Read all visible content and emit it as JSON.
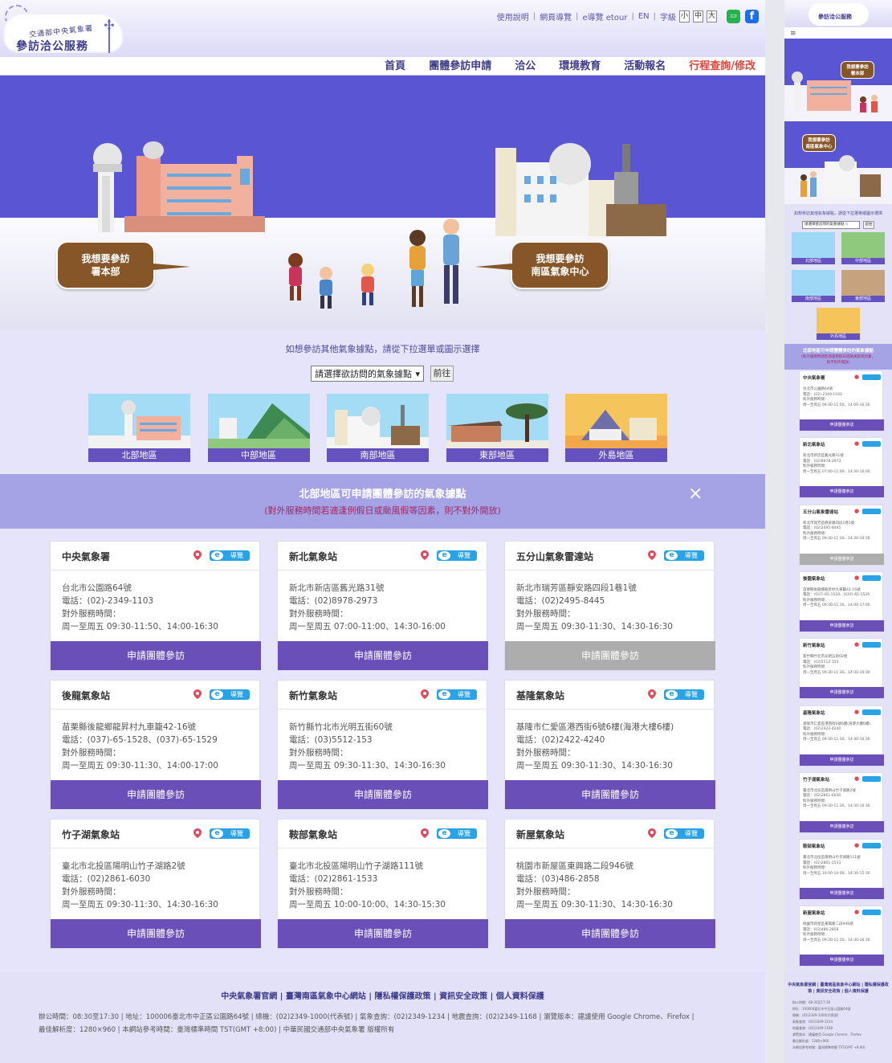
{
  "header": {
    "logo_sub": "交通部中央氣象署",
    "logo_main": "參訪洽公服務",
    "util_links": [
      "使用說明",
      "網頁導覽",
      "e導覽 etour",
      "EN"
    ],
    "font_label": "字級",
    "font_sizes": [
      "小",
      "中",
      "大"
    ],
    "line_label": "LINE",
    "fb_label": "f"
  },
  "nav": [
    "首頁",
    "團體參訪申請",
    "洽公",
    "環境教育",
    "活動報名",
    "行程查詢/修改"
  ],
  "hero": {
    "bubble_left": "我想要參訪\n署本部",
    "bubble_right": "我想要參訪\n南區氣象中心"
  },
  "selector": {
    "prompt": "如想參訪其他氣象據點，請從下拉選單或圖示選擇",
    "select_value": "請選擇欲訪問的氣象據點",
    "go_label": "前往"
  },
  "regions": [
    "北部地區",
    "中部地區",
    "南部地區",
    "東部地區",
    "外島地區"
  ],
  "band": {
    "title": "北部地區可申請團體參訪的氣象據點",
    "note": "(對外服務時間若適逢例假日或颱風假等因素，則不對外開放)",
    "close": "×"
  },
  "tag_label": "導覽",
  "tag_e": "e",
  "cards": [
    {
      "title": "中央氣象署",
      "addr": "台北市公園路64號",
      "tel": "電話：(02)-2349-1103",
      "hours_label": "對外服務時間：",
      "hours": "周一至周五 09:30-11:50、14:00-16:30",
      "btn": "申請團體參訪",
      "disabled": false
    },
    {
      "title": "新北氣象站",
      "addr": "新北市新店區舊光路31號",
      "tel": "電話：(02)8978-2973",
      "hours_label": "對外服務時間：",
      "hours": "周一至周五 07:00-11:00、14:30-16:00",
      "btn": "申請團體參訪",
      "disabled": false
    },
    {
      "title": "五分山氣象雷達站",
      "addr": "新北市瑞芳區靜安路四段1巷1號",
      "tel": "電話：(02)2495-8445",
      "hours_label": "對外服務時間：",
      "hours": "周一至周五 09:30-11:30、14:30-16:30",
      "btn": "申請團體參訪",
      "disabled": true
    },
    {
      "title": "後龍氣象站",
      "addr": "苗栗縣後龍鄉龍昇村九車籠42-16號",
      "tel": "電話：(037)-65-1528、(037)-65-1529",
      "hours_label": "對外服務時間：",
      "hours": "周一至周五 09:30-11:30、14:00-17:00",
      "btn": "申請團體參訪",
      "disabled": false
    },
    {
      "title": "新竹氣象站",
      "addr": "新竹縣竹北市光明五街60號",
      "tel": "電話：(03)5512-153",
      "hours_label": "對外服務時間：",
      "hours": "周一至周五 09:30-11:30、14:30-16:30",
      "btn": "申請團體參訪",
      "disabled": false
    },
    {
      "title": "基隆氣象站",
      "addr": "基隆市仁愛區港西街6號6樓(海港大樓6樓)",
      "tel": "電話：(02)2422-4240",
      "hours_label": "對外服務時間：",
      "hours": "周一至周五 09:30-11:30、14:30-16:30",
      "btn": "申請團體參訪",
      "disabled": false
    },
    {
      "title": "竹子湖氣象站",
      "addr": "臺北市北投區陽明山竹子湖路2號",
      "tel": "電話：(02)2861-6030",
      "hours_label": "對外服務時間：",
      "hours": "周一至周五 09:30-11:30、14:30-16:30",
      "btn": "申請團體參訪",
      "disabled": false
    },
    {
      "title": "鞍部氣象站",
      "addr": "臺北市北投區陽明山竹子湖路111號",
      "tel": "電話：(02)2861-1533",
      "hours_label": "對外服務時間：",
      "hours": "周一至周五 10:00-10:00、14:30-15:30",
      "btn": "申請團體參訪",
      "disabled": false
    },
    {
      "title": "新屋氣象站",
      "addr": "桃園市新屋區東興路二段946號",
      "tel": "電話：(03)486-2858",
      "hours_label": "對外服務時間：",
      "hours": "周一至周五 09:30-11:30、14:30-16:30",
      "btn": "申請團體參訪",
      "disabled": false
    }
  ],
  "footer": {
    "links": "中央氣象署官網 | 臺灣南區氣象中心網站 | 隱私權保護政策 | 資訊安全政策 | 個人資料保護",
    "info1": "辦公時間：08:30至17:30 | 地址：100006臺北市中正區公園路64號 | 總機：(02)2349-1000(代表號) | 氣象查詢：(02)2349-1234 | 地震查詢：(02)2349-1168 | 瀏覽版本：建議使用 Google Chrome、Firefox |",
    "info2": "最佳解析度：1280×960 | 本網站參考時間：臺灣標準時間 TST(GMT +8:00) | 中華民國交通部中央氣象署 版權所有"
  },
  "mobile": {
    "logo": "參訪洽公服務",
    "menu": "≡",
    "bubble1": "我想要參訪\n署本部",
    "bubble2": "我想要參訪\n南區氣象中心",
    "prompt": "如想參訪其他氣象據點，請從下拉選單或圖示選擇",
    "select_value": "請選擇欲訪問的氣象據點 ◇",
    "go": "前往",
    "band_title": "北部地區可申請團體參訪的氣象據點",
    "band_note": "(對外服務時間若適逢例假日或颱風假等因素，\n則不對外開放)",
    "footer_links": "中央氣象署官網 | 臺灣南區氣象中心網站 | 隱私權保護政策 | 資訊安全政策 | 個人資料保護",
    "footer_info": [
      "辦公時間：08:30至17:30",
      "地址：100006臺北市中正區公園路64號",
      "總機：(02)2349-1000(代表號)",
      "氣象查詢：(02)2349-1234",
      "地震查詢：(02)2349-1168",
      "瀏覽版本：建議使用 Google Chrome、Firefox",
      "最佳解析度：1280×960",
      "本網站參考時間：臺灣標準時間 TST(GMT +8:00)"
    ]
  },
  "colors": {
    "accent": "#6a4fb9",
    "hero_bg": "#5a56d3",
    "bubble": "#865528",
    "nav_highlight": "#e2453c",
    "band": "#a6a2e6"
  }
}
